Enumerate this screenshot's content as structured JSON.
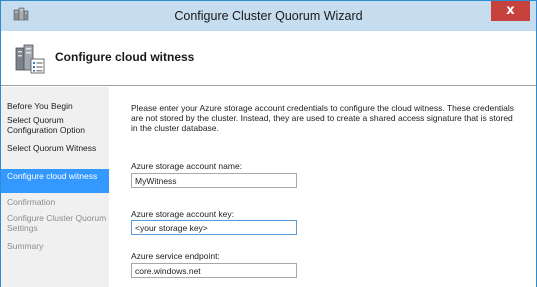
{
  "window": {
    "title": "Configure Cluster Quorum Wizard",
    "close_label": "x"
  },
  "header": {
    "title": "Configure cloud witness"
  },
  "nav": {
    "items": [
      {
        "label": "Before You Begin",
        "state": "normal"
      },
      {
        "label": "Select Quorum Configuration Option",
        "state": "normal"
      },
      {
        "label": "Select Quorum Witness",
        "state": "normal"
      },
      {
        "label": "Configure cloud witness",
        "state": "active"
      },
      {
        "label": "Confirmation",
        "state": "disabled"
      },
      {
        "label": "Configure Cluster Quorum Settings",
        "state": "disabled"
      },
      {
        "label": "Summary",
        "state": "disabled"
      }
    ]
  },
  "content": {
    "intro": "Please enter your Azure storage account credentials to configure the cloud witness. These credentials are not stored by the cluster. Instead, they are used to create a shared access signature that is stored in the cluster database.",
    "account_name_label": "Azure storage account name:",
    "account_name_value": "MyWitness",
    "account_key_label": "Azure storage account key:",
    "account_key_value": "<your storage key>",
    "endpoint_label": "Azure service endpoint:",
    "endpoint_value": "core.windows.net"
  },
  "colors": {
    "titlebar": "#c6dcef",
    "close_button": "#c7423c",
    "nav_background": "#f0f0f0",
    "nav_active": "#3399ff",
    "window_border": "#2e8bd0"
  }
}
